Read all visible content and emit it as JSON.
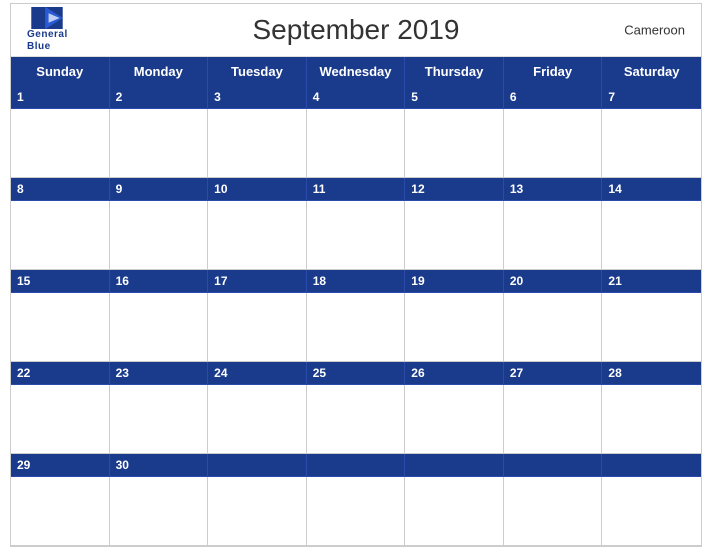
{
  "header": {
    "title": "September 2019",
    "country": "Cameroon",
    "logo_line1": "General",
    "logo_line2": "Blue"
  },
  "days_of_week": [
    "Sunday",
    "Monday",
    "Tuesday",
    "Wednesday",
    "Thursday",
    "Friday",
    "Saturday"
  ],
  "weeks": [
    {
      "dates": [
        "1",
        "2",
        "3",
        "4",
        "5",
        "6",
        "7"
      ],
      "empty": [
        false,
        false,
        false,
        false,
        false,
        false,
        false
      ]
    },
    {
      "dates": [
        "8",
        "9",
        "10",
        "11",
        "12",
        "13",
        "14"
      ],
      "empty": [
        false,
        false,
        false,
        false,
        false,
        false,
        false
      ]
    },
    {
      "dates": [
        "15",
        "16",
        "17",
        "18",
        "19",
        "20",
        "21"
      ],
      "empty": [
        false,
        false,
        false,
        false,
        false,
        false,
        false
      ]
    },
    {
      "dates": [
        "22",
        "23",
        "24",
        "25",
        "26",
        "27",
        "28"
      ],
      "empty": [
        false,
        false,
        false,
        false,
        false,
        false,
        false
      ]
    },
    {
      "dates": [
        "29",
        "30",
        "",
        "",
        "",
        "",
        ""
      ],
      "empty": [
        false,
        false,
        true,
        true,
        true,
        true,
        true
      ]
    }
  ]
}
